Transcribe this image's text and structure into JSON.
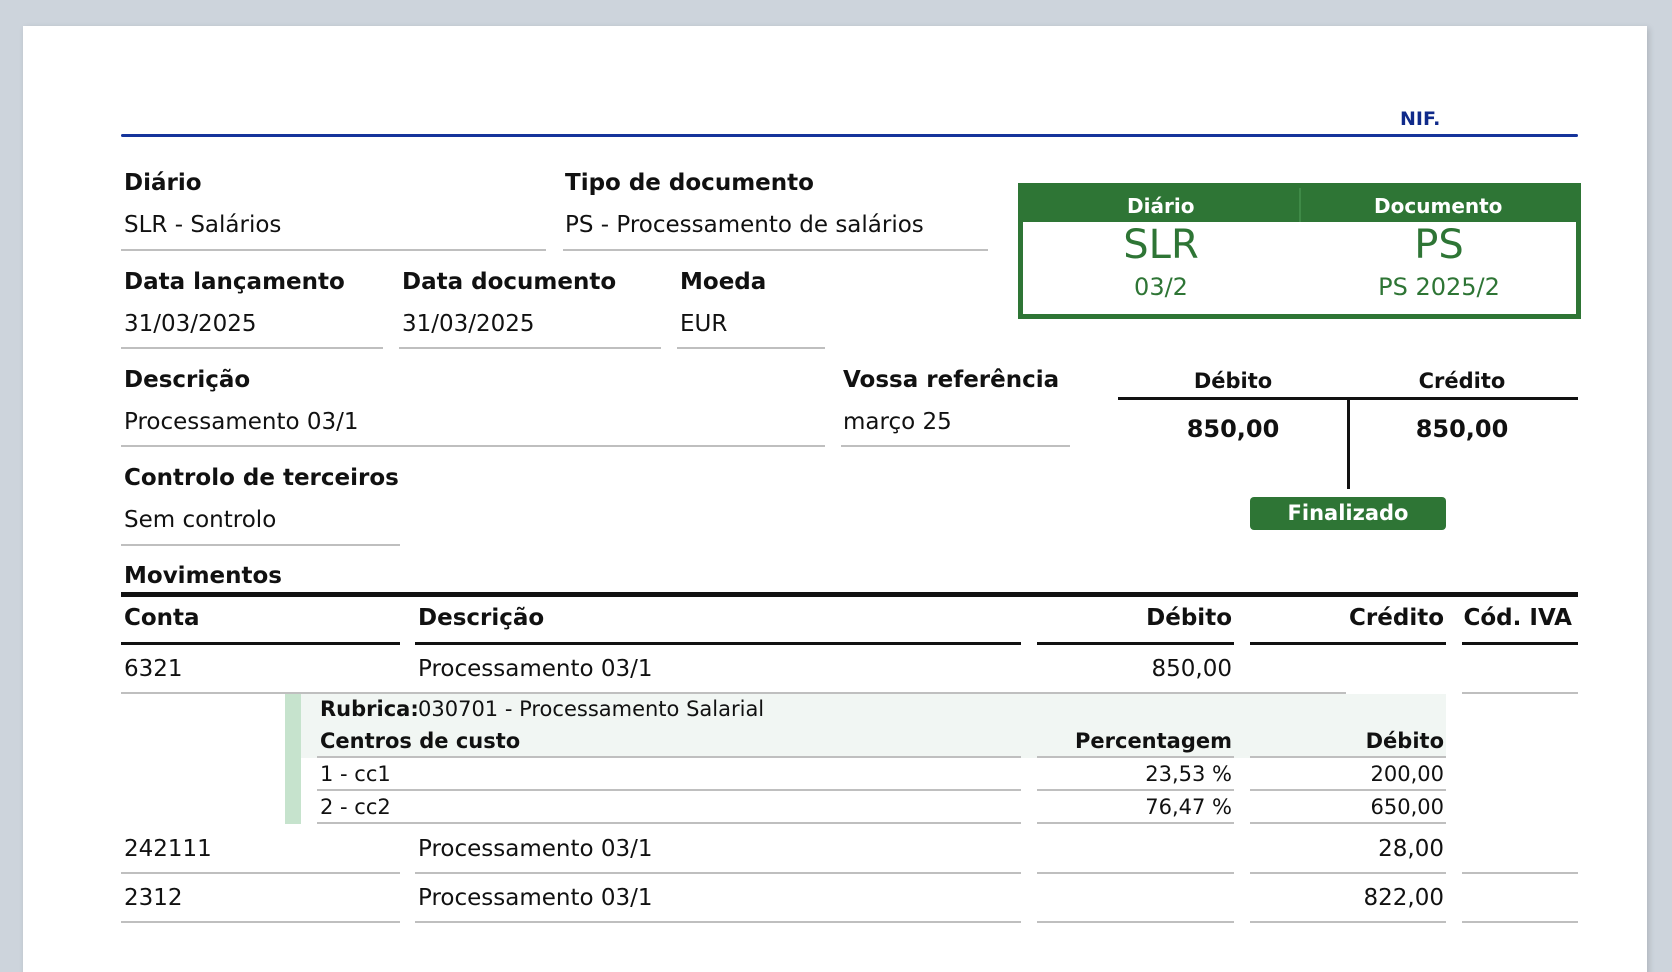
{
  "header": {
    "nif_label": "NIF."
  },
  "fields": {
    "diario": {
      "label": "Diário",
      "value": "SLR - Salários"
    },
    "tipo_documento": {
      "label": "Tipo de documento",
      "value": "PS - Processamento de salários"
    },
    "data_lancamento": {
      "label": "Data lançamento",
      "value": "31/03/2025"
    },
    "data_documento": {
      "label": "Data documento",
      "value": "31/03/2025"
    },
    "moeda": {
      "label": "Moeda",
      "value": "EUR"
    },
    "descricao": {
      "label": "Descrição",
      "value": "Processamento 03/1"
    },
    "vossa_referencia": {
      "label": "Vossa referência",
      "value": "março 25"
    },
    "controlo_terceiros": {
      "label": "Controlo de terceiros",
      "value": "Sem controlo"
    }
  },
  "doc_box": {
    "diario_header": "Diário",
    "documento_header": "Documento",
    "diario_code": "SLR",
    "documento_code": "PS",
    "diario_number": "03/2",
    "documento_number": "PS 2025/2",
    "color": "#2e7535"
  },
  "totals": {
    "debito_label": "Débito",
    "credito_label": "Crédito",
    "debito_value": "850,00",
    "credito_value": "850,00",
    "status": "Finalizado"
  },
  "movimentos": {
    "title": "Movimentos",
    "columns": {
      "conta": "Conta",
      "descricao": "Descrição",
      "debito": "Débito",
      "credito": "Crédito",
      "cod_iva": "Cód. IVA"
    },
    "rows": [
      {
        "conta": "6321",
        "descricao": "Processamento 03/1",
        "debito": "850,00",
        "credito": ""
      },
      {
        "conta": "242111",
        "descricao": "Processamento 03/1",
        "debito": "",
        "credito": "28,00"
      },
      {
        "conta": "2312",
        "descricao": "Processamento 03/1",
        "debito": "",
        "credito": "822,00"
      }
    ],
    "detail": {
      "rubrica_label": "Rubrica:",
      "rubrica_value": "030701 - Processamento Salarial",
      "centros_label": "Centros de custo",
      "percentagem_label": "Percentagem",
      "debito_label": "Débito",
      "items": [
        {
          "centro": "1 - cc1",
          "percentagem": "23,53 %",
          "debito": "200,00"
        },
        {
          "centro": "2 - cc2",
          "percentagem": "76,47 %",
          "debito": "650,00"
        }
      ]
    }
  }
}
